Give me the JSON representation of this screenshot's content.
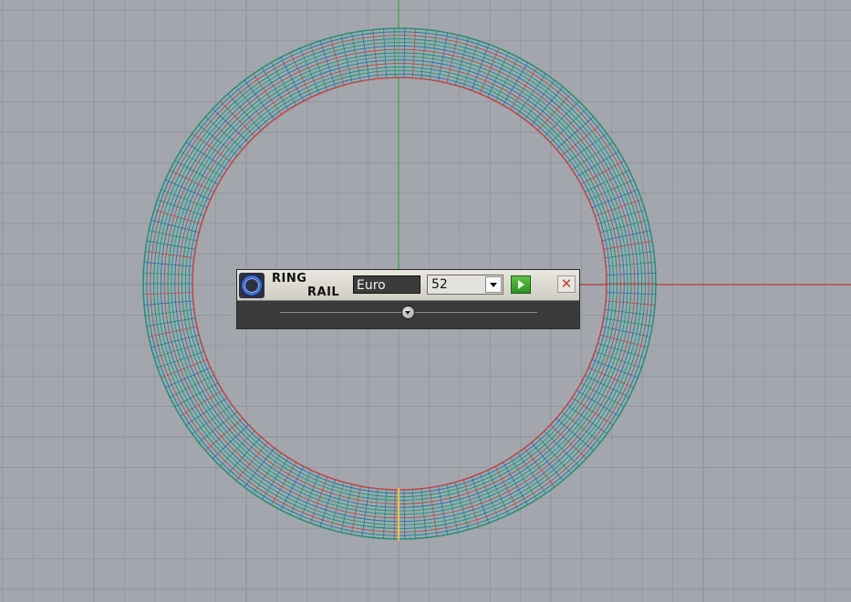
{
  "panel": {
    "title_line1": "RING",
    "title_line2": "RAIL",
    "logo_icon": "ring-icon",
    "size_system": "Euro",
    "ring_size": "52",
    "run_icon": "play-icon",
    "close_icon": "close-icon",
    "close_glyph": "✕"
  },
  "viewport": {
    "background_color": "#a3a7ad",
    "grid_color": "#8c9096",
    "x_axis_color": "#b53a36",
    "y_axis_color": "#38a83a",
    "seam_color": "#f0c040",
    "wire_colors": [
      "#1a8a6a",
      "#1e5fa8",
      "#c8343a",
      "#0f7f7a"
    ]
  }
}
